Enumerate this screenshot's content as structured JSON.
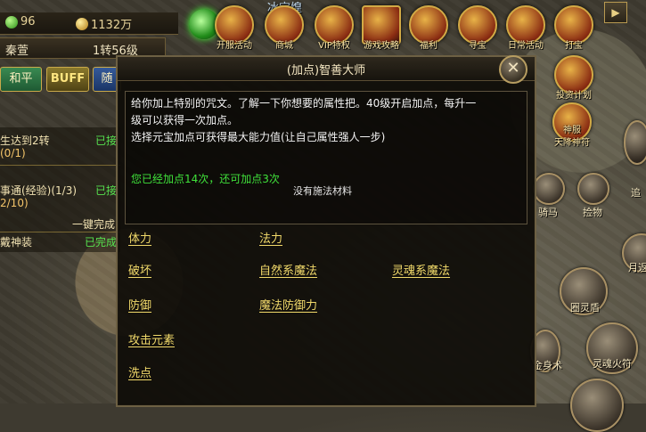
{
  "resources": {
    "green_amount": "96",
    "gold_amount": "1132万"
  },
  "player": {
    "server": "秦萱",
    "level": "1转56级",
    "overhead_name": "冰宝煌"
  },
  "modes": {
    "peace": "和平",
    "buff": "BUFF",
    "other": "随"
  },
  "quests": [
    {
      "title": "生达到2转",
      "status": "已接",
      "sub": "(0/1)"
    },
    {
      "title": "事通(经验)(1/3)",
      "status": "已接",
      "sub": "2/10)"
    },
    {
      "link": "一键完成"
    },
    {
      "title": "戴神装",
      "status": "已完成"
    }
  ],
  "top_icons": [
    {
      "label": "开服活动",
      "icon": "gift-icon"
    },
    {
      "label": "商城",
      "icon": "shop-icon"
    },
    {
      "label": "VIP特权",
      "icon": "vip-icon"
    },
    {
      "label": "游戏攻略",
      "icon": "book-icon"
    },
    {
      "label": "福利",
      "icon": "gift-bag-icon"
    },
    {
      "label": "寻宝",
      "icon": "treasure-icon"
    },
    {
      "label": "日常活动",
      "icon": "calendar-icon"
    },
    {
      "label": "打宝",
      "icon": "helmet-icon"
    }
  ],
  "right_icons": [
    {
      "label": "投资计划"
    },
    {
      "label": "神服",
      "sub": "天降神符"
    },
    {
      "label": "骑马"
    },
    {
      "label": "捡物"
    },
    {
      "label": "月返"
    },
    {
      "label": "圈灵盾"
    },
    {
      "label": "金身术"
    },
    {
      "label": "灵魂火符"
    },
    {
      "label": "追"
    }
  ],
  "dialog": {
    "title": "(加点)智善大师",
    "desc_line1": "给你加上特别的咒文。了解一下你想要的属性把。40级开启加点，每升一",
    "desc_line2": "级可以获得一次加点。",
    "desc_line3": "选择元宝加点可获得最大能力值(让自己属性强人一步)",
    "status": "您已经加点14次，还可加点3次",
    "tip": "没有施法材料",
    "options": {
      "stamina": "体力",
      "magic": "法力",
      "destroy": "破坏",
      "nature": "自然系魔法",
      "soul": "灵魂系魔法",
      "defense": "防御",
      "magic_defense": "魔法防御力",
      "attack_element": "攻击元素",
      "wash": "洗点"
    }
  }
}
